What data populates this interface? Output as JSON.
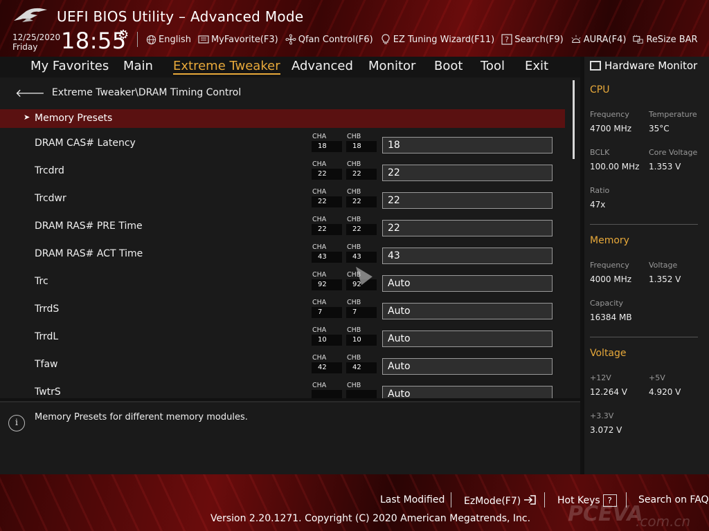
{
  "header": {
    "title": "UEFI BIOS Utility – Advanced Mode",
    "date": "12/25/2020",
    "day": "Friday",
    "time": "18:55",
    "toolbar": [
      {
        "label": "English",
        "icon": "globe-icon"
      },
      {
        "label": "MyFavorite(F3)",
        "icon": "favorite-icon"
      },
      {
        "label": "Qfan Control(F6)",
        "icon": "fan-icon"
      },
      {
        "label": "EZ Tuning Wizard(F11)",
        "icon": "lightbulb-icon"
      },
      {
        "label": "Search(F9)",
        "icon": "search-icon"
      },
      {
        "label": "AURA(F4)",
        "icon": "aura-icon"
      },
      {
        "label": "ReSize BAR",
        "icon": "resize-bar-icon"
      }
    ]
  },
  "nav": {
    "tabs": [
      "My Favorites",
      "Main",
      "Extreme Tweaker",
      "Advanced",
      "Monitor",
      "Boot",
      "Tool",
      "Exit"
    ],
    "active": "Extreme Tweaker"
  },
  "main": {
    "breadcrumb": "Extreme Tweaker\\DRAM Timing Control",
    "preset_label": "Memory Presets",
    "channel_a": "CHA",
    "channel_b": "CHB",
    "rows": [
      {
        "label": "DRAM CAS# Latency",
        "cha": "18",
        "chb": "18",
        "value": "18"
      },
      {
        "label": "Trcdrd",
        "cha": "22",
        "chb": "22",
        "value": "22"
      },
      {
        "label": "Trcdwr",
        "cha": "22",
        "chb": "22",
        "value": "22"
      },
      {
        "label": "DRAM RAS# PRE Time",
        "cha": "22",
        "chb": "22",
        "value": "22"
      },
      {
        "label": "DRAM RAS# ACT Time",
        "cha": "43",
        "chb": "43",
        "value": "43"
      },
      {
        "label": "Trc",
        "cha": "92",
        "chb": "92",
        "value": "Auto"
      },
      {
        "label": "TrrdS",
        "cha": "7",
        "chb": "7",
        "value": "Auto"
      },
      {
        "label": "TrrdL",
        "cha": "10",
        "chb": "10",
        "value": "Auto"
      },
      {
        "label": "Tfaw",
        "cha": "42",
        "chb": "42",
        "value": "Auto"
      },
      {
        "label": "TwtrS",
        "cha": "",
        "chb": "",
        "value": "Auto"
      }
    ]
  },
  "help": {
    "text": "Memory Presets for different memory modules."
  },
  "hardware_monitor": {
    "title": "Hardware Monitor",
    "cpu": {
      "heading": "CPU",
      "frequency_label": "Frequency",
      "frequency": "4700 MHz",
      "temperature_label": "Temperature",
      "temperature": "35°C",
      "bclk_label": "BCLK",
      "bclk": "100.00 MHz",
      "core_voltage_label": "Core Voltage",
      "core_voltage": "1.353 V",
      "ratio_label": "Ratio",
      "ratio": "47x"
    },
    "memory": {
      "heading": "Memory",
      "frequency_label": "Frequency",
      "frequency": "4000 MHz",
      "voltage_label": "Voltage",
      "voltage": "1.352 V",
      "capacity_label": "Capacity",
      "capacity": "16384 MB"
    },
    "voltage": {
      "heading": "Voltage",
      "v12_label": "+12V",
      "v12": "12.264 V",
      "v5_label": "+5V",
      "v5": "4.920 V",
      "v33_label": "+3.3V",
      "v33": "3.072 V"
    }
  },
  "footer": {
    "last_modified": "Last Modified",
    "ezmode": "EzMode(F7)",
    "ezmode_icon": "exit-arrow-icon",
    "hot_keys": "Hot Keys",
    "hot_keys_key": "?",
    "search_faq": "Search on FAQ",
    "copyright": "Version 2.20.1271. Copyright (C) 2020 American Megatrends, Inc.",
    "watermark": "PCEVA",
    "watermark_sub": ".com.cn"
  },
  "colors": {
    "accent": "#e8a93a",
    "highlight_row": "#5a1111",
    "brand_red": "#6a0c0c"
  }
}
